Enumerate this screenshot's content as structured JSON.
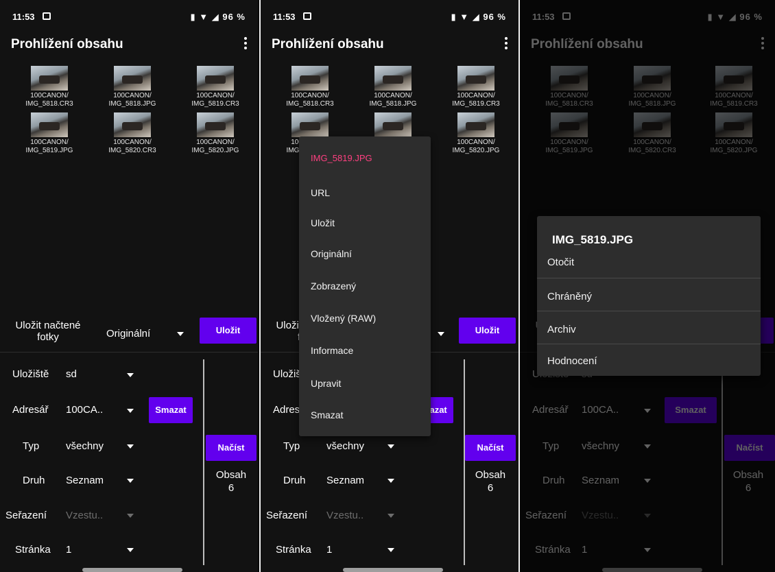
{
  "status": {
    "time": "11:53",
    "battery": "96 %",
    "icons": "vibrate-icon wifi-icon signal-icon"
  },
  "app": {
    "title": "Prohlížení obsahu"
  },
  "thumbnails": [
    {
      "folder": "100CANON/",
      "file": "IMG_5818.CR3"
    },
    {
      "folder": "100CANON/",
      "file": "IMG_5818.JPG"
    },
    {
      "folder": "100CANON/",
      "file": "IMG_5819.CR3"
    },
    {
      "folder": "100CANON/",
      "file": "IMG_5819.JPG"
    },
    {
      "folder": "100CANON/",
      "file": "IMG_5820.CR3"
    },
    {
      "folder": "100CANON/",
      "file": "IMG_5820.JPG"
    }
  ],
  "save": {
    "label_line1": "Uložit načtené",
    "label_line2": "fotky",
    "mode": "Originální",
    "button": "Uložit"
  },
  "controls": {
    "storage_label": "Uložiště",
    "storage_value": "sd",
    "dir_label": "Adresář",
    "dir_value": "100CA..",
    "delete_button": "Smazat",
    "type_label": "Typ",
    "type_value": "všechny",
    "load_button": "Načíst",
    "kind_label": "Druh",
    "kind_value": "Seznam",
    "sort_label": "Seřazení",
    "sort_value": "Vzestu..",
    "page_label": "Stránka",
    "page_value": "1",
    "content_label": "Obsah",
    "content_count": "6"
  },
  "context_menu": {
    "title": "IMG_5819.JPG",
    "items": [
      "URL",
      "Uložit",
      "Originální",
      "Zobrazený",
      "Vložený (RAW)",
      "Informace",
      "Upravit",
      "Smazat"
    ]
  },
  "dialog": {
    "title": "IMG_5819.JPG",
    "items": [
      "Otočit",
      "Chráněný",
      "Archiv",
      "Hodnocení"
    ]
  },
  "colors": {
    "accent": "#6200ee",
    "menu_title": "#ff4081",
    "background": "#121212",
    "popup": "#2d2d2d"
  }
}
